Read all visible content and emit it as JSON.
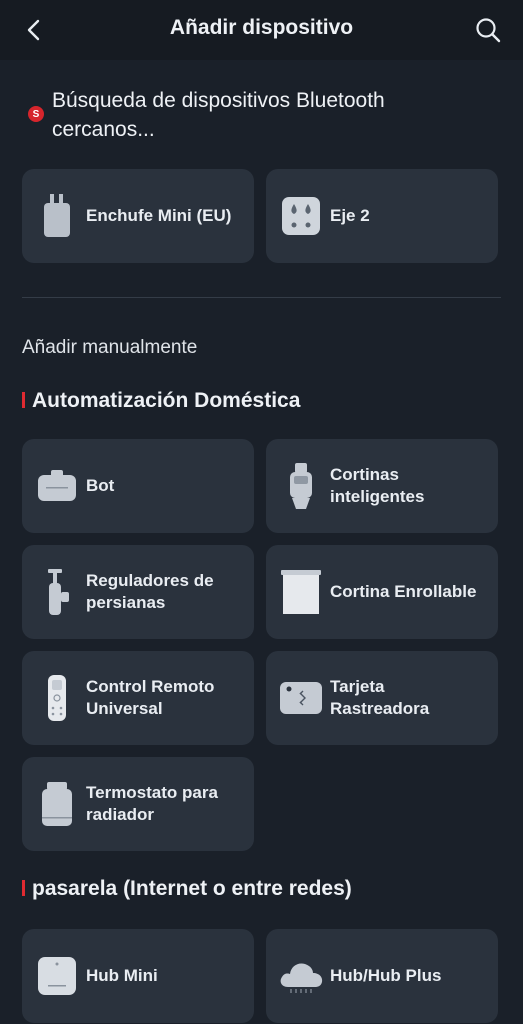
{
  "header": {
    "title": "Añadir dispositivo",
    "back_icon": "chevron-left-icon",
    "search_icon": "search-icon"
  },
  "scan": {
    "badge": "S",
    "text": "Búsqueda de dispositivos Bluetooth cercanos..."
  },
  "nearby": [
    {
      "label": "Enchufe Mini (EU)",
      "icon": "plug-icon"
    },
    {
      "label": "Eje 2",
      "icon": "blind-tilt-icon"
    }
  ],
  "manual_label": "Añadir manualmente",
  "sections": [
    {
      "title": "Automatización Doméstica",
      "items": [
        {
          "label": "Bot",
          "icon": "bot-icon"
        },
        {
          "label": "Cortinas inteligentes",
          "icon": "curtain-icon"
        },
        {
          "label": "Reguladores de persianas",
          "icon": "blind-regulator-icon"
        },
        {
          "label": "Cortina Enrollable",
          "icon": "roller-shade-icon"
        },
        {
          "label": "Control Remoto Universal",
          "icon": "remote-icon"
        },
        {
          "label": "Tarjeta Rastreadora",
          "icon": "tracker-card-icon"
        },
        {
          "label": "Termostato para radiador",
          "icon": "thermostat-icon"
        }
      ]
    },
    {
      "title": "pasarela (Internet o entre redes)",
      "items": [
        {
          "label": "Hub Mini",
          "icon": "hub-mini-icon"
        },
        {
          "label": "Hub/Hub Plus",
          "icon": "cloud-hub-icon"
        }
      ]
    }
  ],
  "colors": {
    "background": "#1a2029",
    "card": "#2a323d",
    "accent": "#e02a31"
  }
}
